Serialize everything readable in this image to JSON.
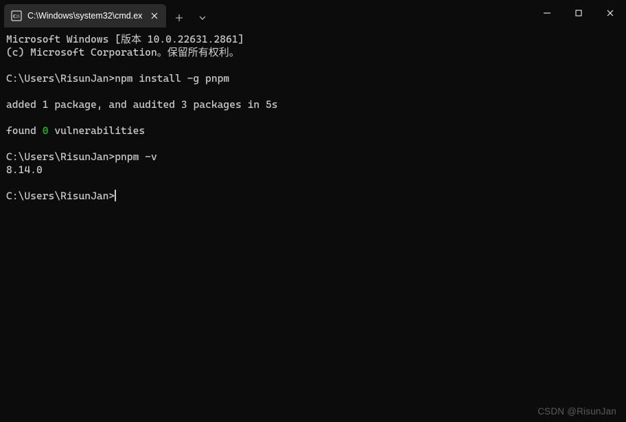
{
  "tab": {
    "title": "C:\\Windows\\system32\\cmd.ex"
  },
  "window_controls": {
    "minimize": "minimize",
    "maximize": "maximize",
    "close": "close"
  },
  "terminal": {
    "lines": [
      {
        "t": "Microsoft Windows [版本 10.0.22631.2861]"
      },
      {
        "t": "(c) Microsoft Corporation。保留所有权利。"
      },
      {
        "t": ""
      },
      {
        "prompt": "C:\\Users\\RisunJan>",
        "cmd": "npm install -g pnpm"
      },
      {
        "t": ""
      },
      {
        "t": "added 1 package, and audited 3 packages in 5s"
      },
      {
        "t": ""
      },
      {
        "pre": "found ",
        "hl": "0",
        "post": " vulnerabilities"
      },
      {
        "t": ""
      },
      {
        "prompt": "C:\\Users\\RisunJan>",
        "cmd": "pnpm -v"
      },
      {
        "t": "8.14.0"
      },
      {
        "t": ""
      },
      {
        "prompt": "C:\\Users\\RisunJan>",
        "cursor": true
      }
    ]
  },
  "watermark": "CSDN @RisunJan"
}
